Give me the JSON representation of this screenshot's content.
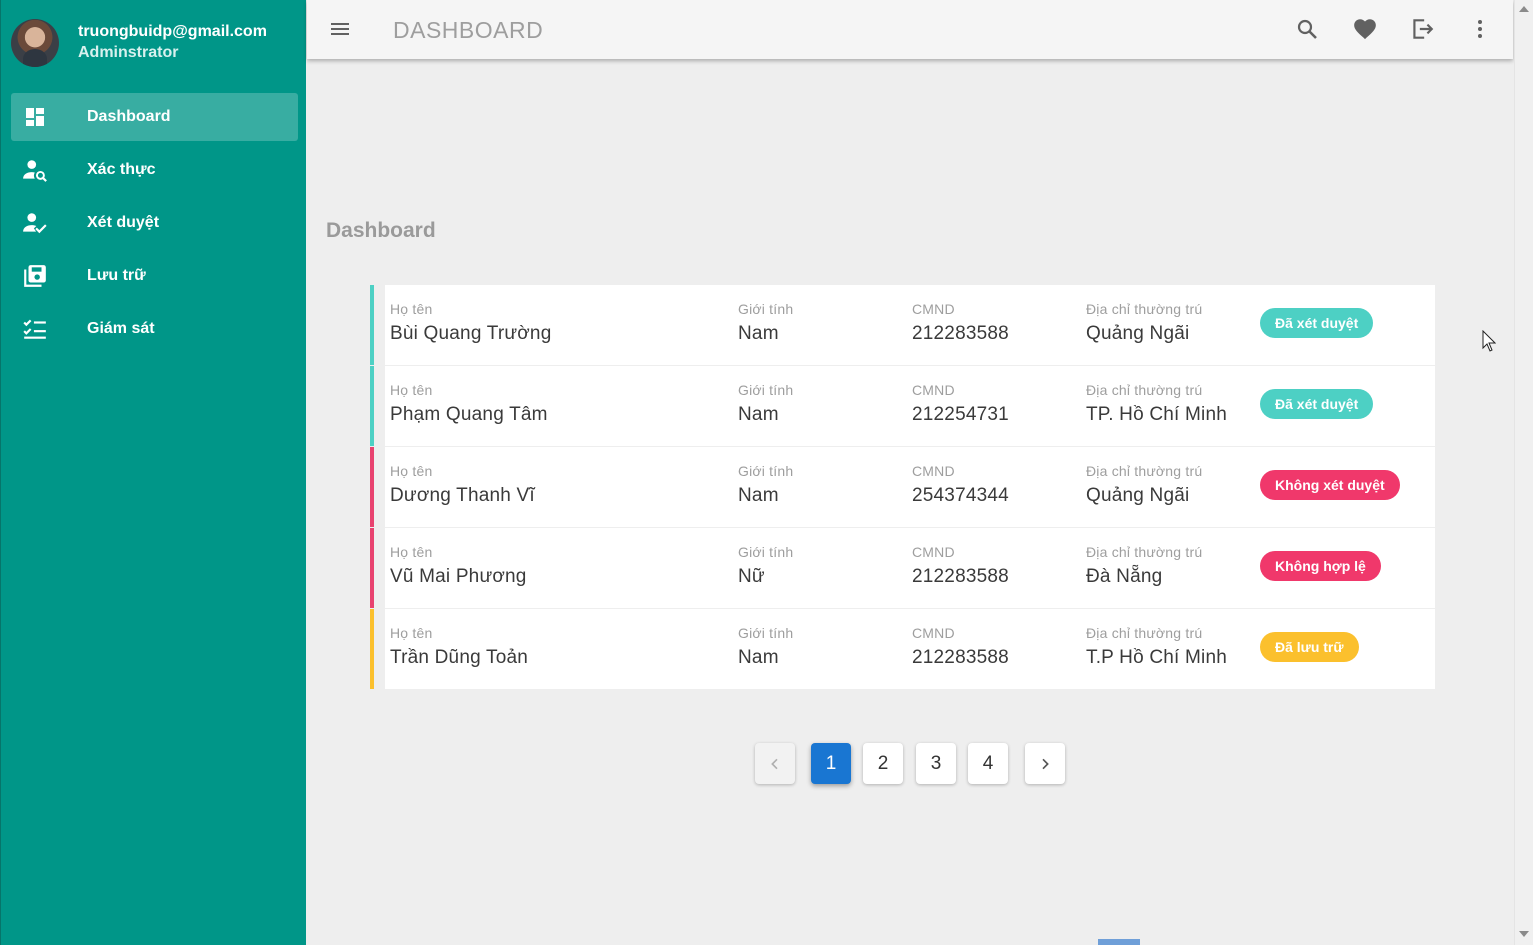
{
  "user": {
    "email": "truongbuidp@gmail.com",
    "role": "Adminstrator"
  },
  "sidebar": {
    "items": [
      {
        "label": "Dashboard",
        "icon": "dashboard-icon",
        "active": true
      },
      {
        "label": "Xác thực",
        "icon": "person-search-icon",
        "active": false
      },
      {
        "label": "Xét duyệt",
        "icon": "person-check-icon",
        "active": false
      },
      {
        "label": "Lưu trữ",
        "icon": "archive-save-icon",
        "active": false
      },
      {
        "label": "Giám sát",
        "icon": "checklist-icon",
        "active": false
      }
    ]
  },
  "topbar": {
    "title": "DASHBOARD",
    "icons": [
      "menu-icon",
      "search-icon",
      "heart-icon",
      "logout-icon",
      "more-vert-icon"
    ]
  },
  "main": {
    "heading": "Dashboard",
    "labels": {
      "name": "Họ tên",
      "gender": "Giới tính",
      "id": "CMND",
      "address": "Địa chỉ thường trú"
    },
    "records": [
      {
        "name": "Bùi Quang Trường",
        "gender": "Nam",
        "id": "212283588",
        "address": "Quảng Ngãi",
        "status": "Đã xét duyệt",
        "status_color": "#4dd0c4",
        "accent": "#4dd0c4"
      },
      {
        "name": "Phạm Quang Tâm",
        "gender": "Nam",
        "id": "212254731",
        "address": "TP. Hồ Chí Minh",
        "status": "Đã xét duyệt",
        "status_color": "#4dd0c4",
        "accent": "#4dd0c4"
      },
      {
        "name": "Dương Thanh Vĩ",
        "gender": "Nam",
        "id": "254374344",
        "address": "Quảng Ngãi",
        "status": "Không xét duyệt",
        "status_color": "#f0386b",
        "accent": "#e8426f"
      },
      {
        "name": "Vũ Mai Phương",
        "gender": "Nữ",
        "id": "212283588",
        "address": "Đà Nẵng",
        "status": "Không hợp lệ",
        "status_color": "#f0386b",
        "accent": "#e8426f"
      },
      {
        "name": "Trần Dũng Toản",
        "gender": "Nam",
        "id": "212283588",
        "address": "T.P Hồ Chí Minh",
        "status": "Đã lưu trữ",
        "status_color": "#fbc02d",
        "accent": "#fbc02d"
      }
    ]
  },
  "pagination": {
    "pages": [
      "1",
      "2",
      "3",
      "4"
    ],
    "current": "1",
    "prev_icon": "chevron-left-icon",
    "next_icon": "chevron-right-icon"
  }
}
